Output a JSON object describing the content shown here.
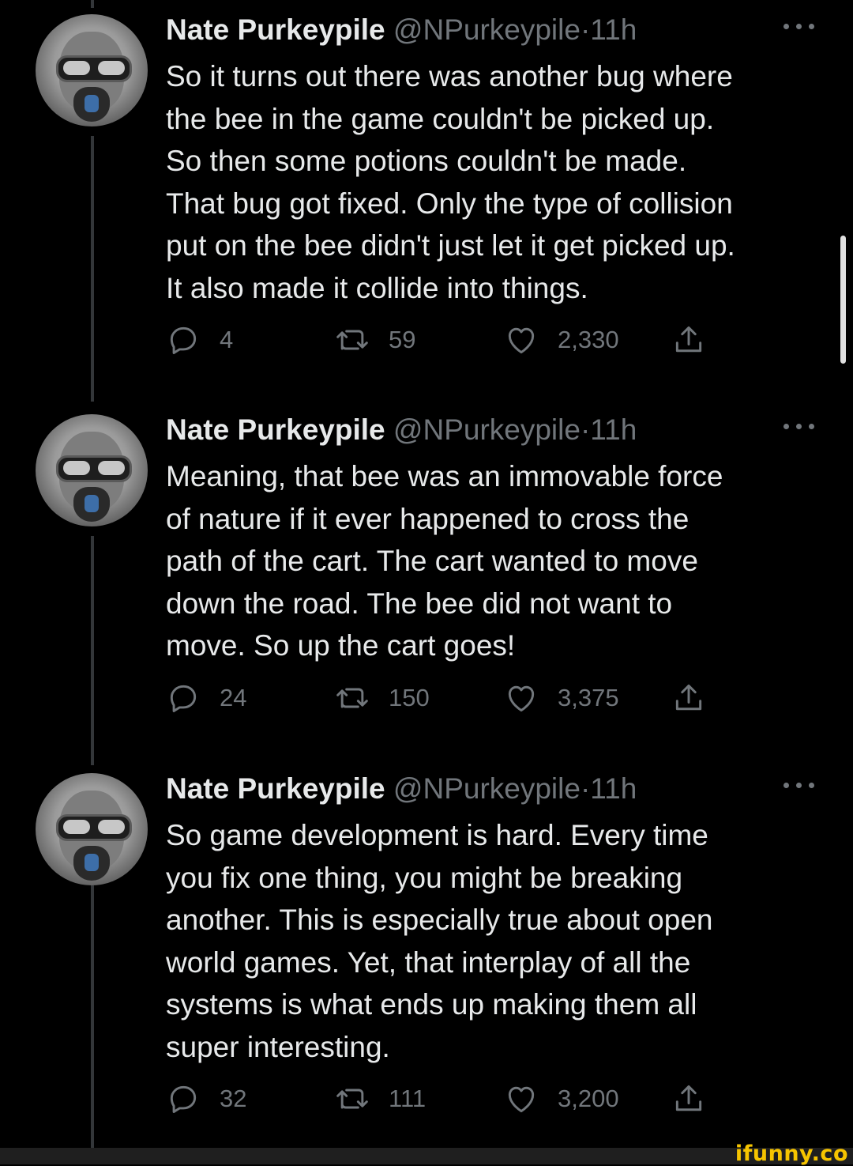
{
  "tweets": [
    {
      "name": "Nate Purkeypile",
      "handle": "@NPurkeypile",
      "dot": "·",
      "time": "11h",
      "text": "So it turns out there was another bug where\nthe bee in the game couldn't be picked up.\nSo then some potions couldn't be made.\nThat bug got fixed. Only the type of collision\nput on the bee didn't just let it get picked up.\nIt also made it collide into things.",
      "replies": "4",
      "retweets": "59",
      "likes": "2,330"
    },
    {
      "name": "Nate Purkeypile",
      "handle": "@NPurkeypile",
      "dot": "·",
      "time": "11h",
      "text": "Meaning, that bee was an immovable force\nof nature if it ever happened to cross the\npath of the cart. The cart wanted to move\ndown the road. The bee did not want to\nmove. So up the cart goes!",
      "replies": "24",
      "retweets": "150",
      "likes": "3,375"
    },
    {
      "name": "Nate Purkeypile",
      "handle": "@NPurkeypile",
      "dot": "·",
      "time": "11h",
      "text": "So game development is hard. Every time\nyou fix one thing, you might be breaking\nanother. This is especially true about open\nworld games. Yet, that interplay of all the\nsystems is what ends up making them all\nsuper interesting.",
      "replies": "32",
      "retweets": "111",
      "likes": "3,200"
    }
  ],
  "icons": {
    "reply": "reply-icon",
    "retweet": "retweet-icon",
    "like": "heart-icon",
    "share": "share-icon",
    "more": "more-icon"
  },
  "colors": {
    "background": "#000000",
    "text": "#e7e9ea",
    "muted": "#71767b",
    "thread_line": "#333639",
    "watermark": "#f6c400"
  },
  "watermark": "ifunny.co"
}
